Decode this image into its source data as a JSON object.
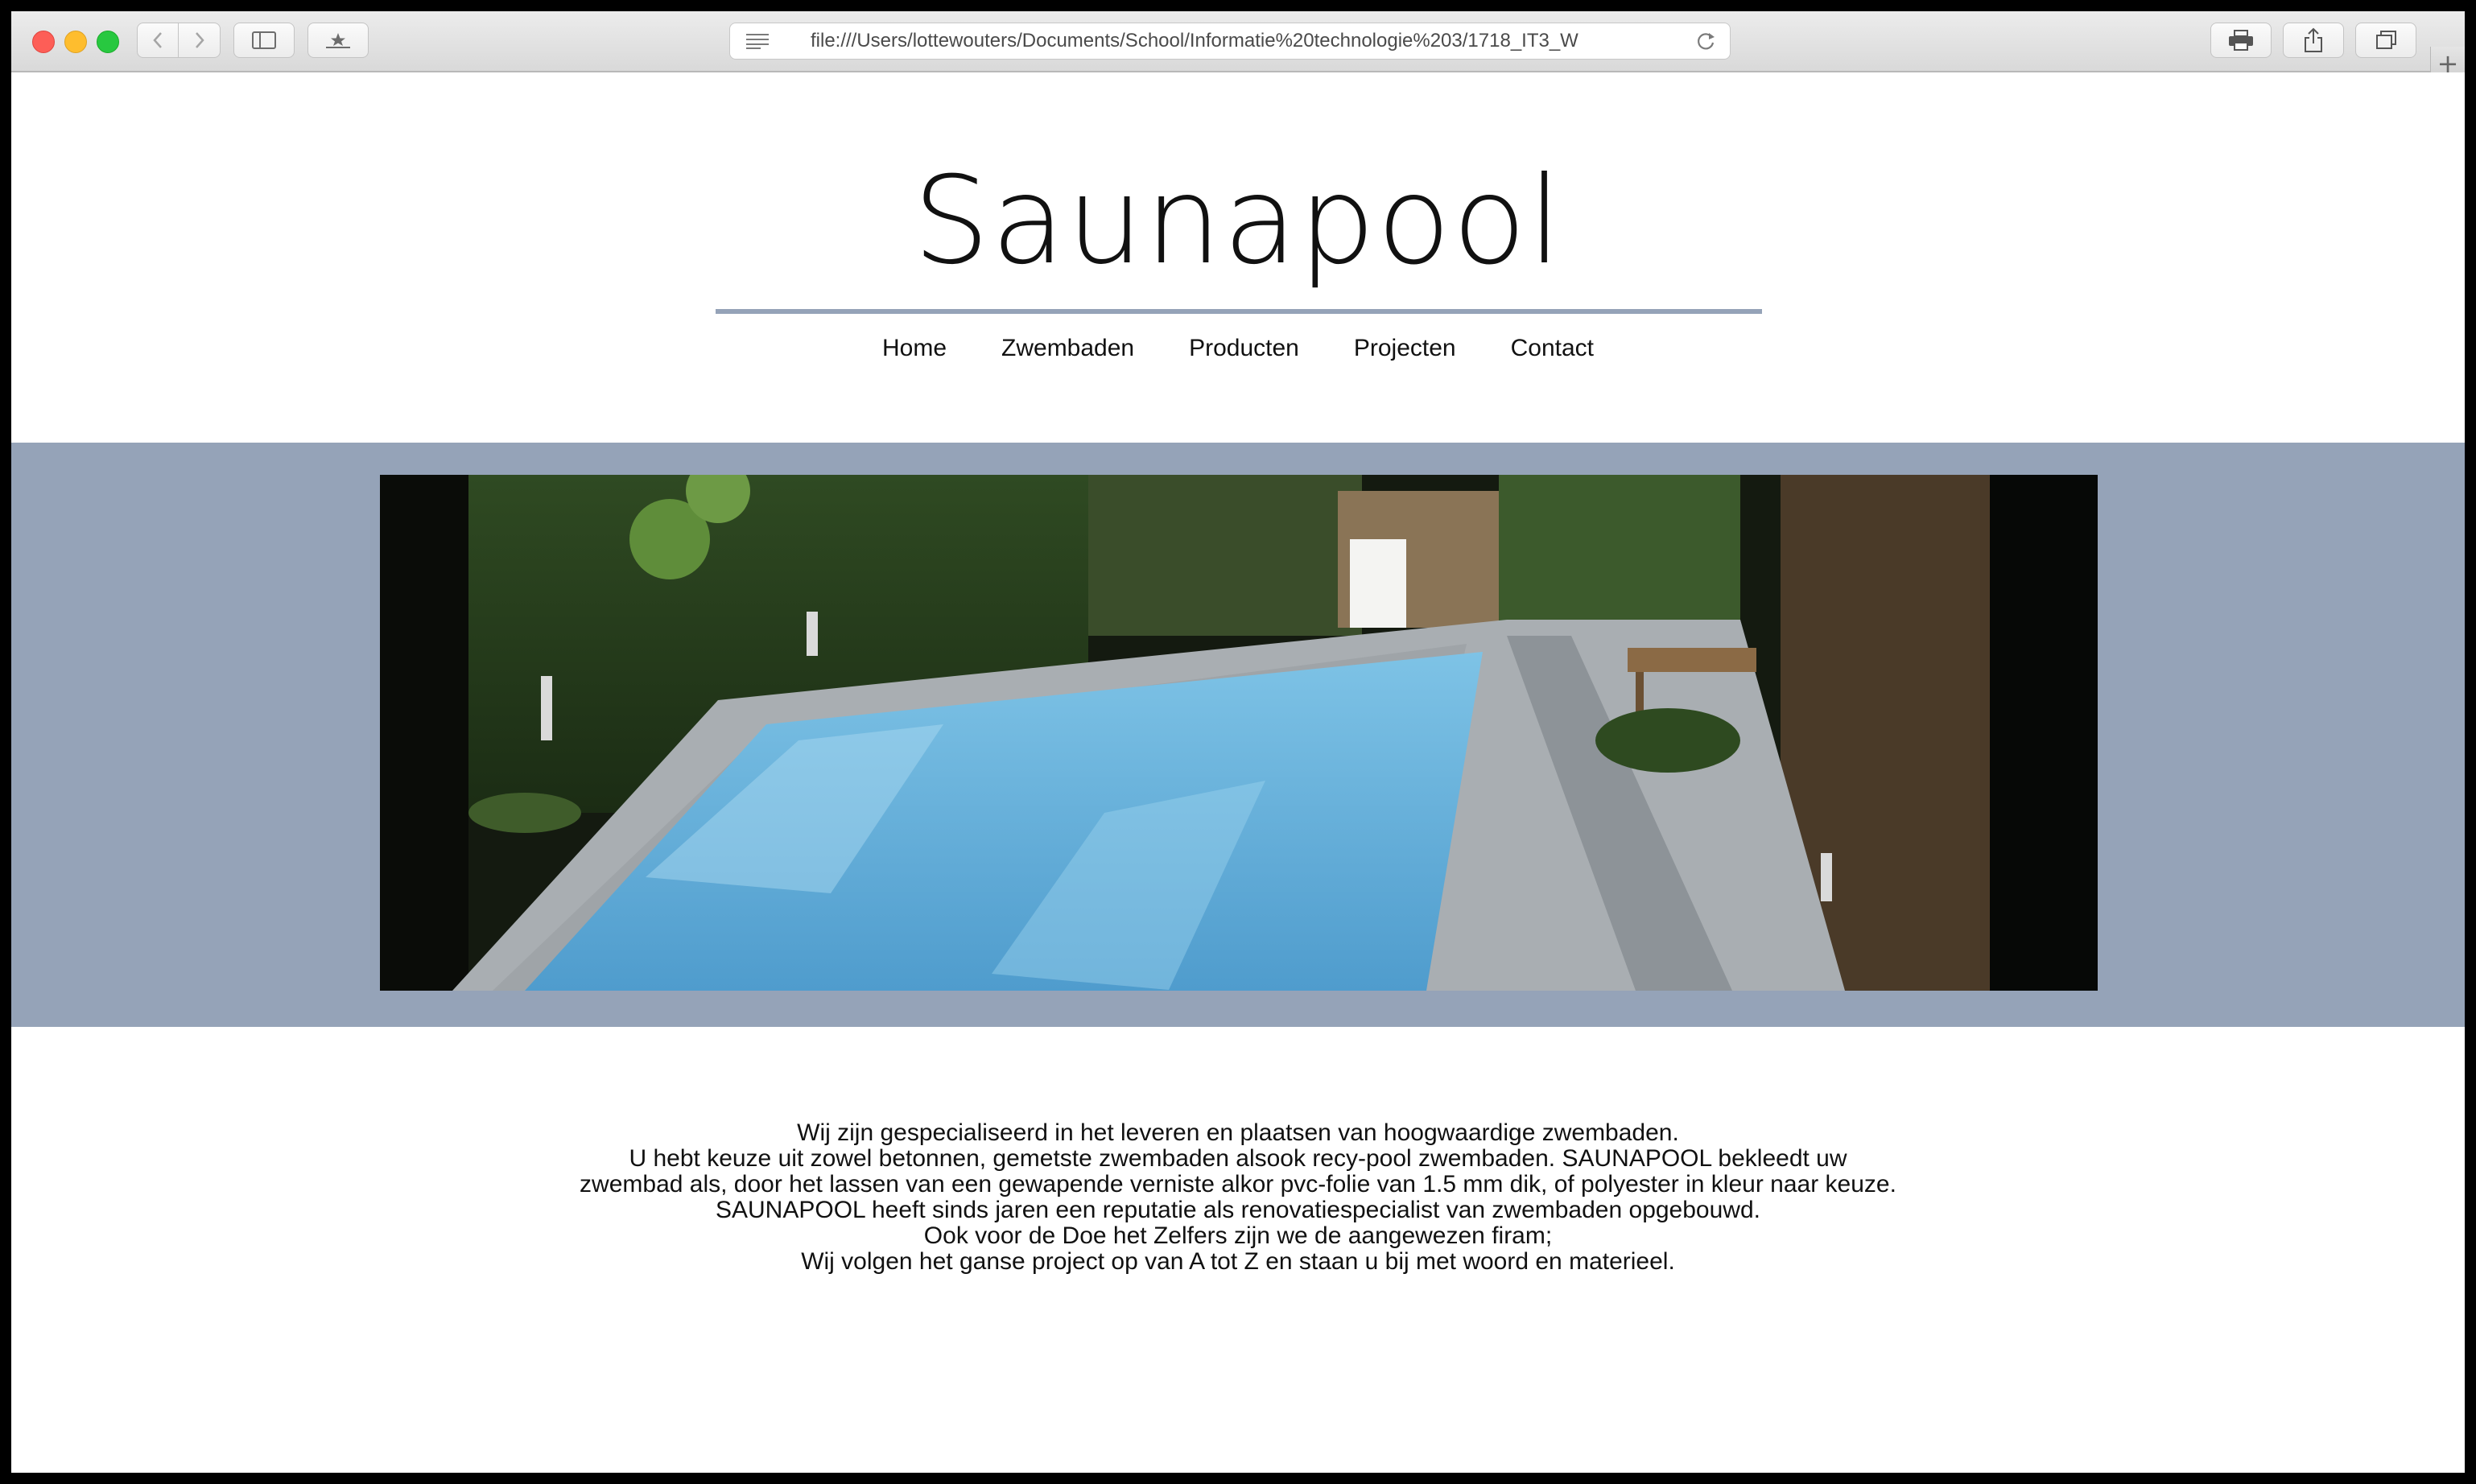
{
  "browser": {
    "url": "file:///Users/lottewouters/Documents/School/Informatie%20technologie%203/1718_IT3_W"
  },
  "site": {
    "title": "Saunapool",
    "nav": [
      "Home",
      "Zwembaden",
      "Producten",
      "Projecten",
      "Contact"
    ],
    "hero_image": "swimming-pool-garden-photo",
    "intro": [
      "Wij zijn gespecialiseerd in het leveren en plaatsen van hoogwaardige zwembaden.",
      "U hebt keuze uit zowel betonnen, gemetste zwembaden alsook recy-pool zwembaden. SAUNAPOOL bekleedt uw",
      "zwembad als, door het lassen van een gewapende verniste alkor pvc-folie van 1.5 mm dik, of polyester in kleur naar keuze.",
      "SAUNAPOOL heeft sinds jaren een reputatie als renovatiespecialist van zwembaden opgebouwd.",
      "Ook voor de Doe het Zelfers zijn we de aangewezen firam;",
      "Wij volgen het ganse project op van A tot Z en staan u bij met woord en materieel."
    ]
  },
  "colors": {
    "accent": "#95a3b8",
    "pool_water": "#6fb4dc"
  }
}
